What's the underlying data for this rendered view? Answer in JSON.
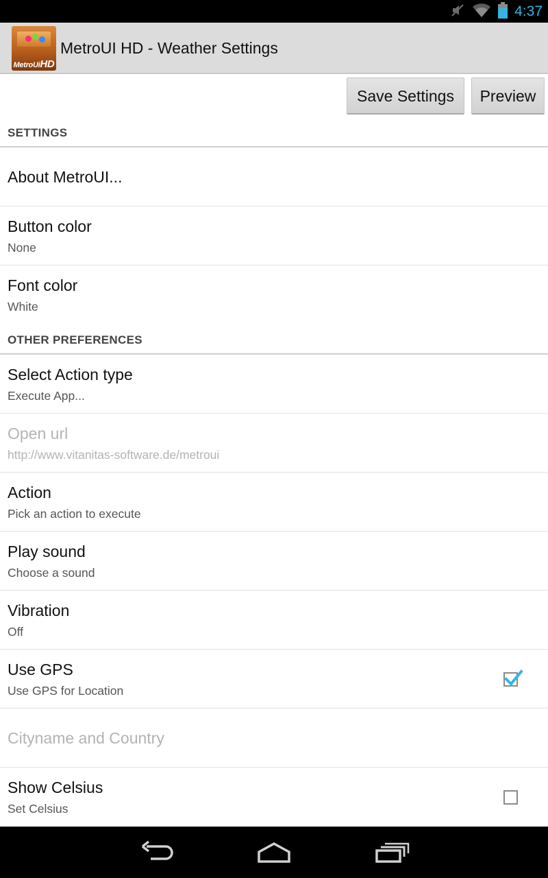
{
  "status_bar": {
    "time": "4:37",
    "icons": [
      "mute-icon",
      "wifi-icon",
      "battery-icon"
    ],
    "accent_color": "#33b5e5"
  },
  "action_bar": {
    "app_icon_label_prefix": "MetroUi",
    "app_icon_label_suffix": "HD",
    "title": "MetroUI HD - Weather Settings"
  },
  "buttons": {
    "save_label": "Save Settings",
    "preview_label": "Preview"
  },
  "sections": [
    {
      "header": "SETTINGS",
      "items": [
        {
          "title": "About MetroUI..."
        },
        {
          "title": "Button color",
          "summary": "None"
        },
        {
          "title": "Font color",
          "summary": "White"
        }
      ]
    },
    {
      "header": "OTHER PREFERENCES",
      "items": [
        {
          "title": "Select Action type",
          "summary": "Execute App..."
        },
        {
          "title": "Open url",
          "summary": "http://www.vitanitas-software.de/metroui",
          "enabled": false
        },
        {
          "title": "Action",
          "summary": "Pick an action to execute"
        },
        {
          "title": "Play sound",
          "summary": "Choose a sound"
        },
        {
          "title": "Vibration",
          "summary": "Off"
        },
        {
          "title": "Use GPS",
          "summary": "Use GPS for Location",
          "checkbox": true,
          "checked": true
        },
        {
          "title": "Cityname and Country",
          "enabled": false
        },
        {
          "title": "Show Celsius",
          "summary": "Set Celsius",
          "checkbox": true,
          "checked": false
        }
      ]
    }
  ],
  "nav_bar": {
    "icons": [
      "back-icon",
      "home-icon",
      "recent-apps-icon"
    ]
  }
}
